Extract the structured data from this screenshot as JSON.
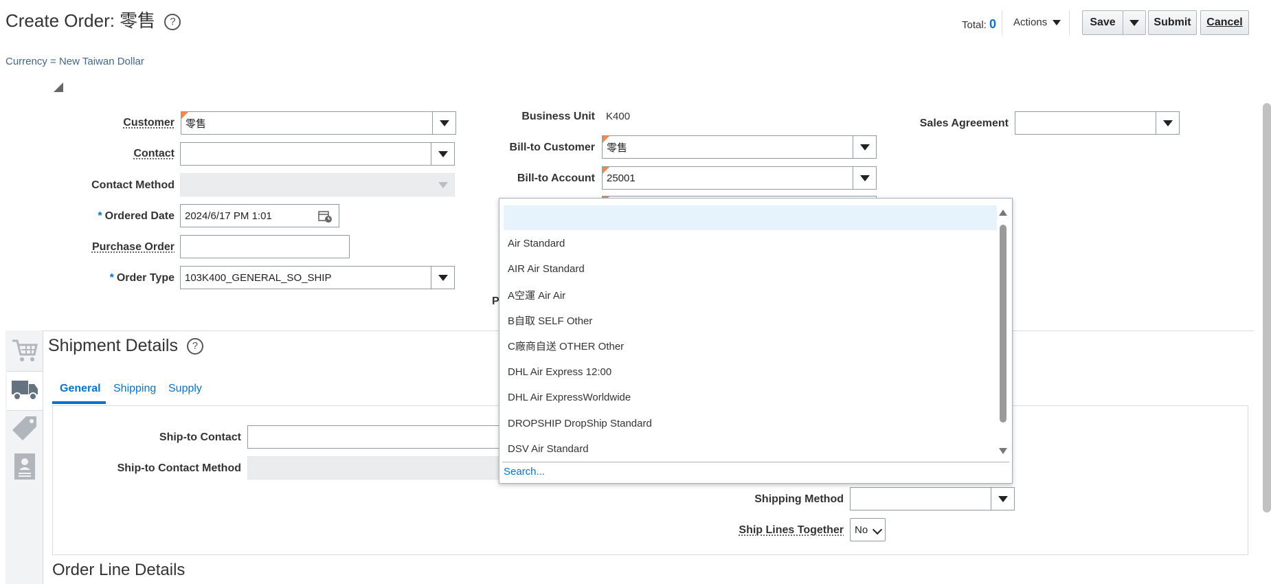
{
  "header": {
    "title": "Create Order: 零售",
    "currency": "Currency = New Taiwan Dollar",
    "total_label": "Total:",
    "total_value": "0",
    "actions_label": "Actions",
    "save_label": "Save",
    "submit_label": "Submit",
    "cancel_label": "Cancel"
  },
  "form_left": {
    "customer_label": "Customer",
    "customer_value": "零售",
    "contact_label": "Contact",
    "contact_value": "",
    "contact_method_label": "Contact Method",
    "ordered_date_label": "Ordered Date",
    "ordered_date_value": "2024/6/17 PM 1:01",
    "purchase_order_label": "Purchase Order",
    "purchase_order_value": "",
    "order_type_label": "Order Type",
    "order_type_value": "103K400_GENERAL_SO_SHIP",
    "required_mark": "*"
  },
  "form_mid": {
    "business_unit_label": "Business Unit",
    "business_unit_value": "K400",
    "bill_to_customer_label": "Bill-to Customer",
    "bill_to_customer_value": "零售",
    "bill_to_account_label": "Bill-to Account",
    "bill_to_account_value": "25001",
    "partial_label": "P"
  },
  "form_right": {
    "sales_agreement_label": "Sales Agreement",
    "sales_agreement_value": ""
  },
  "shipment": {
    "title": "Shipment Details",
    "tabs": [
      "General",
      "Shipping",
      "Supply"
    ],
    "ship_to_contact_label": "Ship-to Contact",
    "ship_to_contact_method_label": "Ship-to Contact Method",
    "shipping_method_label": "Shipping Method",
    "ship_lines_together_label": "Ship Lines Together",
    "ship_lines_together_value": "No"
  },
  "order_lines": {
    "title": "Order Line Details"
  },
  "dropdown": {
    "options": [
      "",
      "Air Standard",
      "AIR Air Standard",
      "A空運 Air Air",
      "B自取 SELF Other",
      "C廠商自送 OTHER Other",
      "DHL Air Express 12:00",
      "DHL Air ExpressWorldwide",
      "DROPSHIP DropShip Standard",
      "DSV Air Standard"
    ],
    "search_link": "Search..."
  },
  "icons": {
    "help": "question-circle-icon",
    "cart": "cart-icon",
    "truck": "truck-icon",
    "tag": "tag-icon",
    "badge": "id-badge-icon",
    "calendar": "calendar-clock-icon"
  },
  "colors": {
    "accent": "#0572ce",
    "required_marker": "#f2894b",
    "dropdown_highlight": "#e6f2fc"
  }
}
